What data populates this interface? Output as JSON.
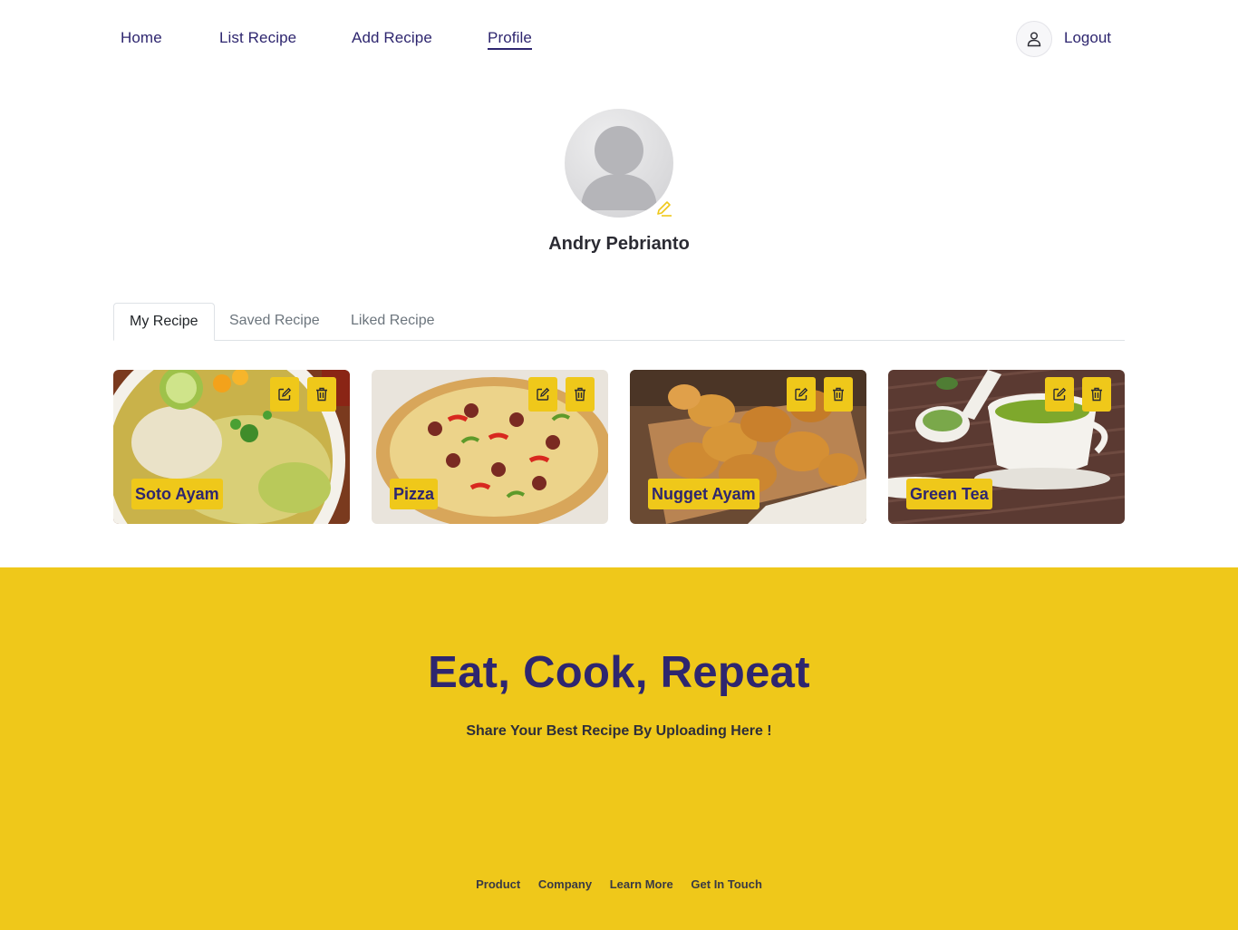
{
  "nav": {
    "items": [
      {
        "label": "Home"
      },
      {
        "label": "List Recipe"
      },
      {
        "label": "Add Recipe"
      },
      {
        "label": "Profile"
      }
    ],
    "active": "Profile",
    "logout_label": "Logout"
  },
  "profile": {
    "name": "Andry Pebrianto"
  },
  "tabs": [
    {
      "label": "My Recipe"
    },
    {
      "label": "Saved Recipe"
    },
    {
      "label": "Liked Recipe"
    }
  ],
  "active_tab": "My Recipe",
  "recipes": [
    {
      "title": "Soto Ayam"
    },
    {
      "title": "Pizza"
    },
    {
      "title": "Nugget Ayam"
    },
    {
      "title": "Green Tea"
    }
  ],
  "footer": {
    "title": "Eat, Cook, Repeat",
    "subtitle": "Share Your Best Recipe By Uploading Here !",
    "links": [
      "Product",
      "Company",
      "Learn More",
      "Get In Touch"
    ]
  },
  "colors": {
    "accent": "#efc81a",
    "primary_text": "#2e266f"
  }
}
